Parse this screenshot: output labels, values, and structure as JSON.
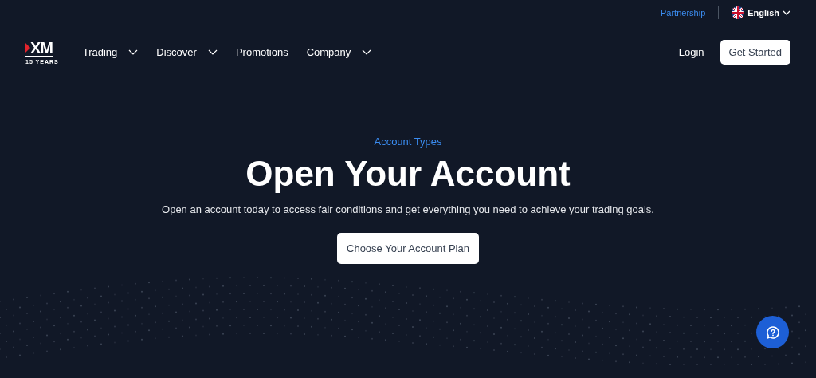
{
  "top_bar": {
    "partnership": "Partnership",
    "language": "English"
  },
  "logo": {
    "mark": "XM",
    "tagline": "15 YEARS"
  },
  "nav": [
    {
      "label": "Trading",
      "dropdown": true
    },
    {
      "label": "Discover",
      "dropdown": true
    },
    {
      "label": "Promotions",
      "dropdown": false
    },
    {
      "label": "Company",
      "dropdown": true
    }
  ],
  "login": "Login",
  "get_started": "Get Started",
  "hero": {
    "eyebrow": "Account Types",
    "title": "Open Your Account",
    "subtitle": "Open an account today to access fair conditions and get everything you need to achieve your trading goals.",
    "button": "Choose Your Account Plan"
  }
}
